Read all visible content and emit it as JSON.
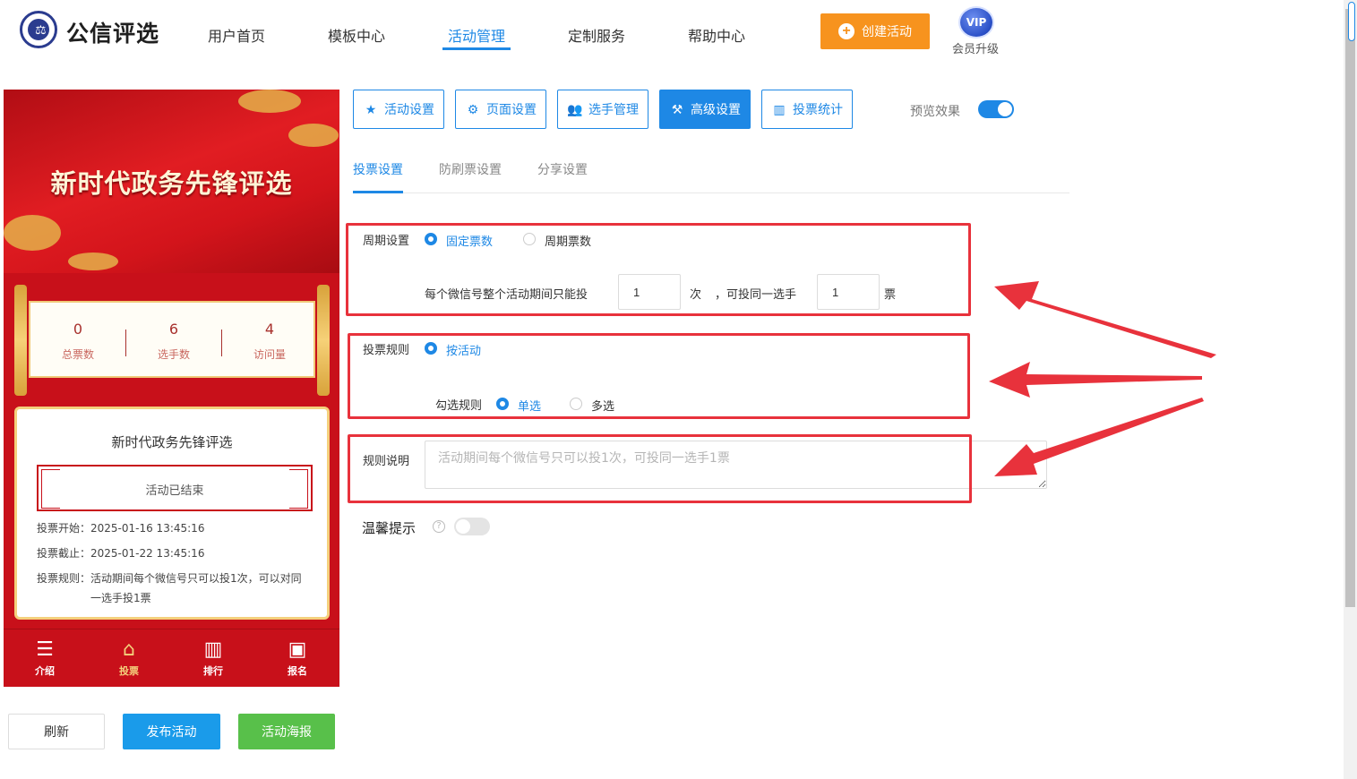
{
  "header": {
    "brand": "公信评选",
    "nav": [
      "用户首页",
      "模板中心",
      "活动管理",
      "定制服务",
      "帮助中心"
    ],
    "create_label": "创建活动",
    "vip_text": "VIP",
    "vip_label": "会员升级"
  },
  "preview": {
    "banner_title": "新时代政务先锋评选",
    "stats": [
      {
        "value": "0",
        "label": "总票数"
      },
      {
        "value": "6",
        "label": "选手数"
      },
      {
        "value": "4",
        "label": "访问量"
      }
    ],
    "card_title": "新时代政务先锋评选",
    "status": "活动已结束",
    "start": "投票开始：2025-01-16 13:45:16",
    "end": "投票截止：2025-01-22 13:45:16",
    "rule_line1": "投票规则：活动期间每个微信号只可以投1次，可以对同",
    "rule_line2": "一选手投1票",
    "tabbar": [
      {
        "label": "介绍",
        "icon": "document-icon"
      },
      {
        "label": "投票",
        "icon": "home-icon"
      },
      {
        "label": "排行",
        "icon": "bar-chart-icon"
      },
      {
        "label": "报名",
        "icon": "clipboard-icon"
      }
    ]
  },
  "actions": {
    "refresh": "刷新",
    "publish": "发布活动",
    "poster": "活动海报"
  },
  "settings": {
    "tabs": [
      "活动设置",
      "页面设置",
      "选手管理",
      "高级设置",
      "投票统计"
    ],
    "preview_label": "预览效果",
    "sub_tabs": [
      "投票设置",
      "防刷票设置",
      "分享设置"
    ],
    "cycle_label": "周期设置",
    "cycle_opt1": "固定票数",
    "cycle_opt2": "周期票数",
    "cycle_desc": "每个微信号整个活动期间只能投",
    "times_value": "1",
    "times_unit": "次",
    "same_player_text": "，可投同一选手",
    "votes_value": "1",
    "votes_unit": "票",
    "rule_label": "投票规则",
    "rule_opt": "按活动",
    "check_label": "勾选规则",
    "check_opt1": "单选",
    "check_opt2": "多选",
    "desc_label": "规则说明",
    "desc_placeholder": "活动期间每个微信号只可以投1次，可投同一选手1票",
    "tip_label": "温馨提示",
    "help_glyph": "?"
  },
  "colors": {
    "accent": "#1e88e5",
    "highlight": "#e8323c",
    "orange": "#f7931e",
    "phone_red": "#c8101a"
  }
}
